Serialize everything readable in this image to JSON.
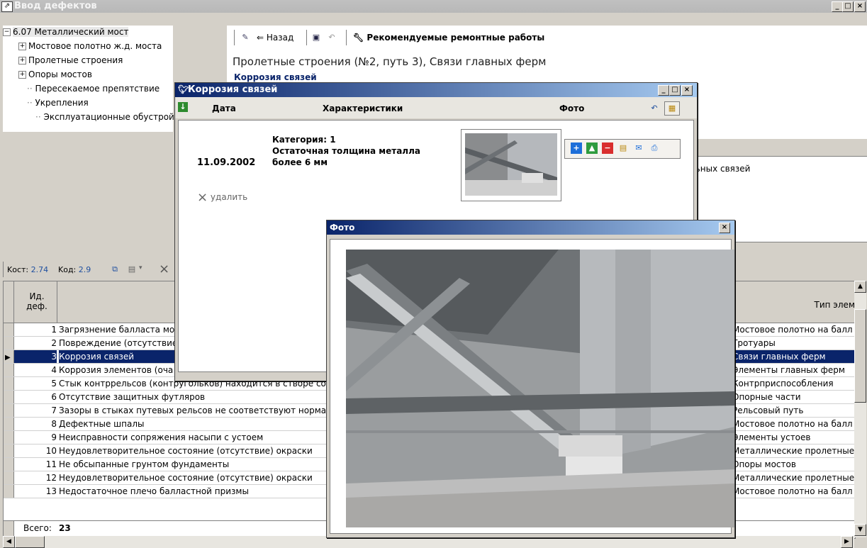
{
  "main_window": {
    "title": "Ввод дефектов",
    "min": "_",
    "max": "□",
    "close": "×"
  },
  "tree": {
    "root": "6.07 Металлический мост",
    "items": [
      {
        "label": "Мостовое полотно ж.д. моста",
        "expandable": true
      },
      {
        "label": "Пролетные строения",
        "expandable": true
      },
      {
        "label": "Опоры мостов",
        "expandable": true
      },
      {
        "label": "Пересекаемое препятствие",
        "expandable": false
      },
      {
        "label": "Укрепления",
        "expandable": false
      },
      {
        "label": "Эксплуатационные обустрой",
        "expandable": false
      }
    ]
  },
  "toolbar": {
    "back_label": "Назад",
    "repairs_label": "Рекомендуемые ремонтные работы"
  },
  "element_title": "Пролетные строения (№2, путь 3), Связи главных ферм",
  "defect_title": "Коррозия связей",
  "description_text": "льных связей",
  "koef": {
    "kost_label": "Kост:",
    "kost_value": "2.74",
    "kod_label": "Kод:",
    "kod_value": "2.9"
  },
  "table": {
    "col_id": "Ид. деф.",
    "col_type": "Тип элем",
    "rows": [
      {
        "id": "1",
        "name": "Загрязнение балласта мо",
        "type": "Мостовое полотно на балл"
      },
      {
        "id": "2",
        "name": "Повреждение (отсутствие",
        "type": "Тротуары"
      },
      {
        "id": "3",
        "name": "Коррозия связей",
        "type": "Связи главных ферм"
      },
      {
        "id": "4",
        "name": "Коррозия элементов (оча",
        "type": "Элементы главных ферм"
      },
      {
        "id": "5",
        "name": "Стык контррельсов (контругольков) находится в створе со с",
        "type": "Контрприспособления"
      },
      {
        "id": "6",
        "name": "Отсутствие защитных футляров",
        "type": "Опорные части"
      },
      {
        "id": "7",
        "name": "Зазоры в стыках путевых рельсов не соответствуют нормат",
        "type": "Рельсовый путь"
      },
      {
        "id": "8",
        "name": "Дефектные шпалы",
        "type": "Мостовое полотно на балл"
      },
      {
        "id": "9",
        "name": "Неисправности сопряжения насыпи с устоем",
        "type": "Элементы устоев"
      },
      {
        "id": "10",
        "name": "Неудовлетворительное состояние (отсутствие) окраски",
        "type": "Металлические пролетные"
      },
      {
        "id": "11",
        "name": "Не обсыпанные грунтом фундаменты",
        "type": "Опоры мостов"
      },
      {
        "id": "12",
        "name": "Неудовлетворительное состояние (отсутствие) окраски",
        "type": "Металлические пролетные"
      },
      {
        "id": "13",
        "name": "Недостаточное плечо балластной призмы",
        "type": "Мостовое полотно на балл"
      }
    ],
    "selected_row": 3,
    "total_label": "Всего:",
    "total_value": "23"
  },
  "corrosion_window": {
    "title": "Коррозия связей",
    "col_date": "Дата",
    "col_chars": "Характеристики",
    "col_photo": "Фото",
    "date": "11.09.2002",
    "char_line1": "Категория: 1",
    "char_line2": "Остаточная толщина металла",
    "char_line3": "более 6 мм",
    "delete_label": "удалить"
  },
  "photo_window": {
    "title": "Фото",
    "close": "×"
  },
  "colors": {
    "selection": "#0a246a",
    "title_gradient_start": "#0a246a",
    "title_gradient_end": "#a6caf0"
  }
}
